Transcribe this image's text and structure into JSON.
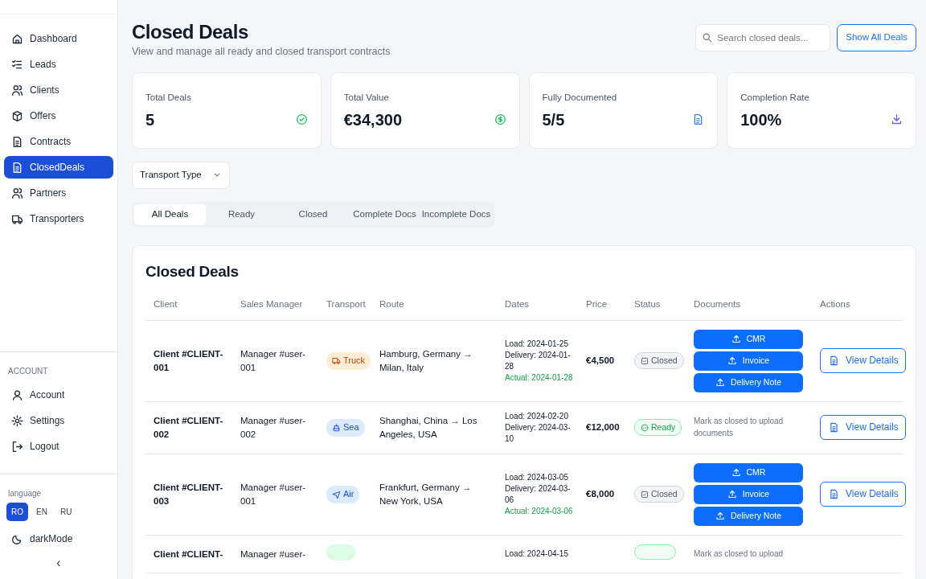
{
  "sidebar": {
    "items": [
      {
        "label": "Dashboard",
        "kind": "home",
        "selected": false
      },
      {
        "label": "Leads",
        "kind": "checklist",
        "selected": false
      },
      {
        "label": "Clients",
        "kind": "users",
        "selected": false
      },
      {
        "label": "Offers",
        "kind": "package",
        "selected": false
      },
      {
        "label": "Contracts",
        "kind": "doc",
        "selected": false
      },
      {
        "label": "ClosedDeals",
        "kind": "doc",
        "selected": true
      },
      {
        "label": "Partners",
        "kind": "users",
        "selected": false
      },
      {
        "label": "Transporters",
        "kind": "truck",
        "selected": false
      }
    ],
    "account_heading": "ACCOUNT",
    "account_items": [
      {
        "label": "Account",
        "kind": "user"
      },
      {
        "label": "Settings",
        "kind": "gear"
      },
      {
        "label": "Logout",
        "kind": "logout"
      }
    ],
    "language_label": "language",
    "languages": [
      {
        "label": "RO",
        "selected": true
      },
      {
        "label": "EN",
        "selected": false
      },
      {
        "label": "RU",
        "selected": false
      }
    ],
    "dark_mode": "darkMode",
    "collapse": "‹"
  },
  "header": {
    "title": "Closed Deals",
    "subtitle": "View and manage all ready and closed transport contracts",
    "search": {
      "placeholder": "Search closed deals..."
    },
    "button": "Show All Deals"
  },
  "stats": [
    {
      "label": "Total Deals",
      "value": "5",
      "kind": "check",
      "color": "#22c55e"
    },
    {
      "label": "Total Value",
      "value": "€34,300",
      "kind": "dollar",
      "color": "#22c55e"
    },
    {
      "label": "Fully Documented",
      "value": "5/5",
      "kind": "doc",
      "color": "#3b82f6"
    },
    {
      "label": "Completion Rate",
      "value": "100%",
      "kind": "download",
      "color": "#6366f1"
    }
  ],
  "filter": {
    "label": "Transport Type"
  },
  "tabs": [
    {
      "label": "All Deals",
      "selected": true
    },
    {
      "label": "Ready",
      "selected": false
    },
    {
      "label": "Closed",
      "selected": false
    },
    {
      "label": "Complete Docs",
      "selected": false
    },
    {
      "label": "Incomplete Docs",
      "selected": false
    }
  ],
  "table": {
    "title": "Closed Deals",
    "columns": [
      "Client",
      "Sales Manager",
      "Transport",
      "Route",
      "Dates",
      "Price",
      "Status",
      "Documents",
      "Actions"
    ],
    "rows": [
      {
        "client": "Client #CLIENT-001",
        "manager": "Manager #user-001",
        "transport": {
          "kind": "truck",
          "label": "Truck"
        },
        "route": "Hamburg, Germany → Milan, Italy",
        "load": "Load: 2024-01-25",
        "delivery": "Delivery: 2024-01-28",
        "actual": "Actual: 2024-01-28",
        "price": "€4,500",
        "status": {
          "kind": "closed",
          "label": "Closed"
        },
        "documents": [
          "CMR",
          "Invoice",
          "Delivery Note"
        ],
        "action": "View Details"
      },
      {
        "client": "Client #CLIENT-002",
        "manager": "Manager #user-002",
        "transport": {
          "kind": "sea",
          "label": "Sea"
        },
        "route": "Shanghai, China → Los Angeles, USA",
        "load": "Load: 2024-02-20",
        "delivery": "Delivery: 2024-03-10",
        "price": "€12,000",
        "status": {
          "kind": "ready",
          "label": "Ready"
        },
        "documents_note": "Mark as closed to upload documents",
        "action": "View Details"
      },
      {
        "client": "Client #CLIENT-003",
        "manager": "Manager #user-001",
        "transport": {
          "kind": "air",
          "label": "Air"
        },
        "route": "Frankfurt, Germany → New York, USA",
        "load": "Load: 2024-03-05",
        "delivery": "Delivery: 2024-03-06",
        "actual": "Actual: 2024-03-06",
        "price": "€8,000",
        "status": {
          "kind": "closed",
          "label": "Closed"
        },
        "documents": [
          "CMR",
          "Invoice",
          "Delivery Note"
        ],
        "action": "View Details"
      },
      {
        "client": "Client #CLIENT-",
        "manager": "Manager #user-",
        "transport": {
          "kind": "green"
        },
        "load": "Load: 2024-04-15",
        "status": {
          "kind": "ready"
        },
        "documents_note": "Mark as closed to upload"
      }
    ]
  }
}
